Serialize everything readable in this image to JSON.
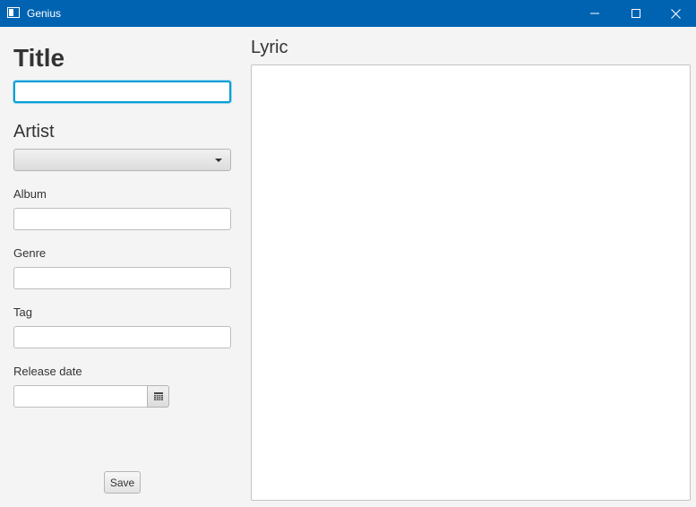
{
  "window": {
    "title": "Genius",
    "title_bar_color": "#0063b1",
    "controls": [
      "minimize-icon",
      "maximize-icon",
      "close-icon"
    ]
  },
  "form": {
    "title_label": "Title",
    "title_value": "",
    "artist_label": "Artist",
    "artist_selected": "",
    "album_label": "Album",
    "album_value": "",
    "genre_label": "Genre",
    "genre_value": "",
    "tag_label": "Tag",
    "tag_value": "",
    "release_date_label": "Release date",
    "release_date_value": "",
    "save_label": "Save"
  },
  "lyric": {
    "label": "Lyric",
    "value": ""
  },
  "colors": {
    "focus_border": "#039ed3",
    "background": "#f4f4f4"
  }
}
